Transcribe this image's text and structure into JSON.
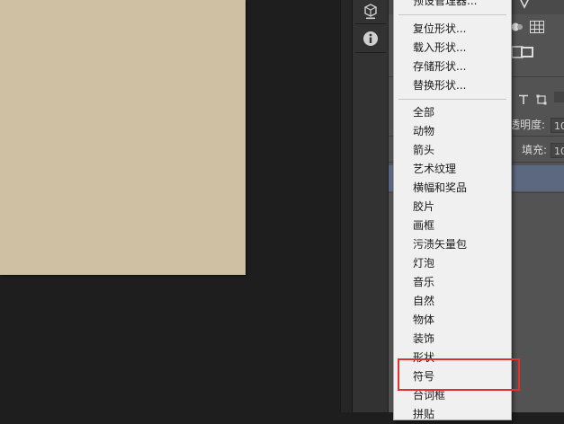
{
  "menu": {
    "top_items": [
      "预设管理器..."
    ],
    "group1": [
      "复位形状...",
      "载入形状...",
      "存储形状...",
      "替换形状..."
    ],
    "group2": [
      "全部",
      "动物",
      "箭头",
      "艺术纹理",
      "横幅和奖品",
      "胶片",
      "画框",
      "污渍矢量包",
      "灯泡",
      "音乐",
      "自然",
      "物体",
      "装饰",
      "形状",
      "符号",
      "台词框",
      "拼贴"
    ]
  },
  "panel": {
    "opacity_label": "透明度:",
    "opacity_value": "10",
    "fill_label": "填充:",
    "fill_value": "10"
  },
  "highlight": {
    "item": "符号",
    "color": "#e0322c"
  },
  "colors": {
    "canvas": "#cfbfa3",
    "menu_bg": "#f0f0f0",
    "panel_bg": "#535353",
    "workspace": "#1e1e1e"
  }
}
